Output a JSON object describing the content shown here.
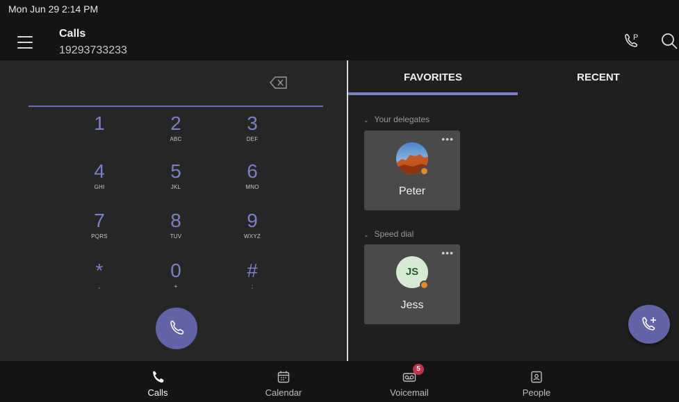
{
  "status": {
    "datetime": "Mon Jun 29  2:14 PM"
  },
  "header": {
    "title": "Calls",
    "number": "19293733233",
    "icons": [
      "menu-icon",
      "call-park-icon",
      "search-icon"
    ]
  },
  "dialpad": {
    "keys": [
      {
        "digit": "1",
        "letters": ""
      },
      {
        "digit": "2",
        "letters": "ABC"
      },
      {
        "digit": "3",
        "letters": "DEF"
      },
      {
        "digit": "4",
        "letters": "GHI"
      },
      {
        "digit": "5",
        "letters": "JKL"
      },
      {
        "digit": "6",
        "letters": "MNO"
      },
      {
        "digit": "7",
        "letters": "PQRS"
      },
      {
        "digit": "8",
        "letters": "TUV"
      },
      {
        "digit": "9",
        "letters": "WXYZ"
      },
      {
        "digit": "*",
        "letters": ","
      },
      {
        "digit": "0",
        "letters": "+"
      },
      {
        "digit": "#",
        "letters": ";"
      }
    ]
  },
  "tabs": {
    "favorites": "FAVORITES",
    "recent": "RECENT"
  },
  "favorites": {
    "sections": [
      {
        "label": "Your delegates",
        "contact": {
          "name": "Peter",
          "initials": "",
          "presence": "away"
        }
      },
      {
        "label": "Speed dial",
        "contact": {
          "name": "Jess",
          "initials": "JS",
          "presence": "away"
        }
      }
    ],
    "more_label": "•••"
  },
  "bottomnav": {
    "items": [
      {
        "label": "Calls",
        "icon": "phone-icon",
        "active": true
      },
      {
        "label": "Calendar",
        "icon": "calendar-icon",
        "active": false
      },
      {
        "label": "Voicemail",
        "icon": "voicemail-icon",
        "active": false,
        "badge": "5"
      },
      {
        "label": "People",
        "icon": "people-icon",
        "active": false
      }
    ]
  },
  "colors": {
    "accent": "#6264a7",
    "presence_away": "#e08a2b",
    "badge": "#c4314b"
  }
}
